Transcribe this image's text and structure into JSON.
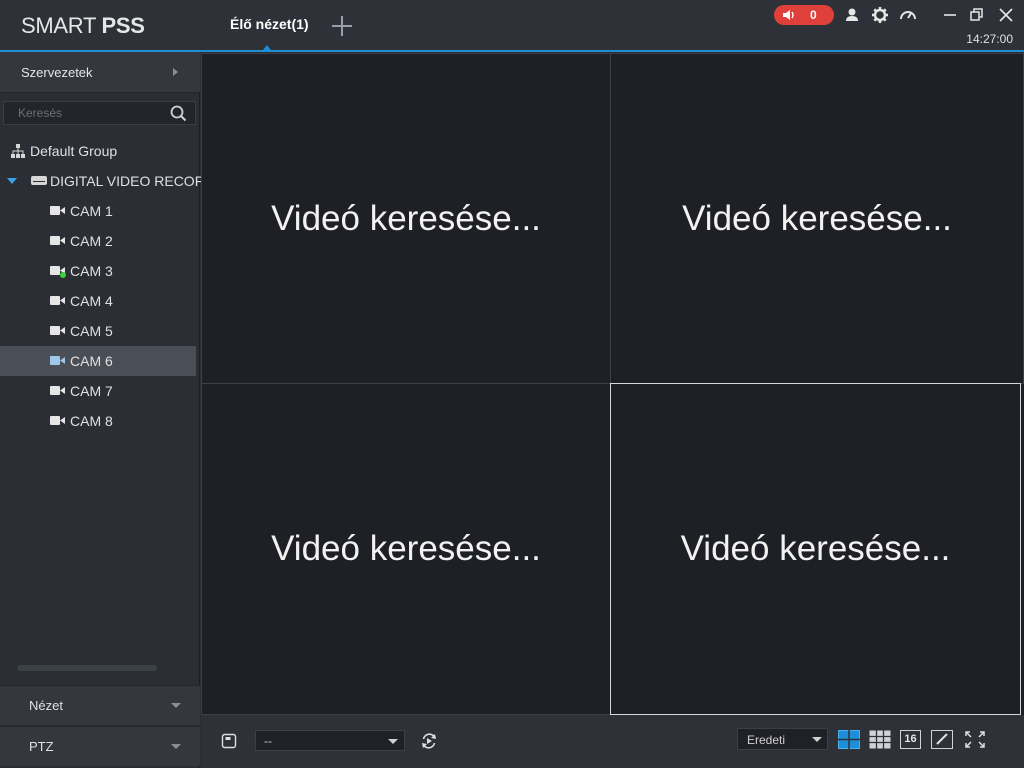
{
  "app": {
    "logo_regular": "SMART ",
    "logo_bold": "PSS",
    "tab_label": "Élő nézet(1)",
    "alarm_count": "0",
    "clock": "14:27:00"
  },
  "sidebar": {
    "org_header": "Szervezetek",
    "search_placeholder": "Keresés",
    "tree": {
      "group": "Default Group",
      "device": "DIGITAL VIDEO RECOF",
      "cameras": [
        "CAM 1",
        "CAM 2",
        "CAM 3",
        "CAM 4",
        "CAM 5",
        "CAM 6",
        "CAM 7",
        "CAM 8"
      ],
      "selected_index": 5,
      "online_index": 2
    },
    "panels": {
      "view": "Nézet",
      "ptz": "PTZ"
    }
  },
  "grid": {
    "cells": [
      "Videó keresése...",
      "Videó keresése...",
      "Videó keresése...",
      "Videó keresése..."
    ],
    "active_index": 3
  },
  "toolbar": {
    "view_select": "--",
    "ratio_select": "Eredeti",
    "layout16_label": "16"
  },
  "colors": {
    "accent": "#1e8fd6",
    "alarm": "#e0403a",
    "online": "#3ad13a",
    "selected_row": "#4a4e56"
  },
  "icons": {
    "alarm": "speaker-icon",
    "user": "user-icon",
    "settings": "gear-icon",
    "performance": "gauge-icon",
    "minimize": "minimize-icon",
    "restore": "restore-icon",
    "close": "close-icon",
    "search": "search-icon",
    "save": "save-view-icon",
    "refresh": "refresh-icon",
    "layout4": "layout-4-icon",
    "layout9": "layout-9-icon",
    "edit": "edit-layout-icon",
    "fullscreen": "fullscreen-icon"
  }
}
